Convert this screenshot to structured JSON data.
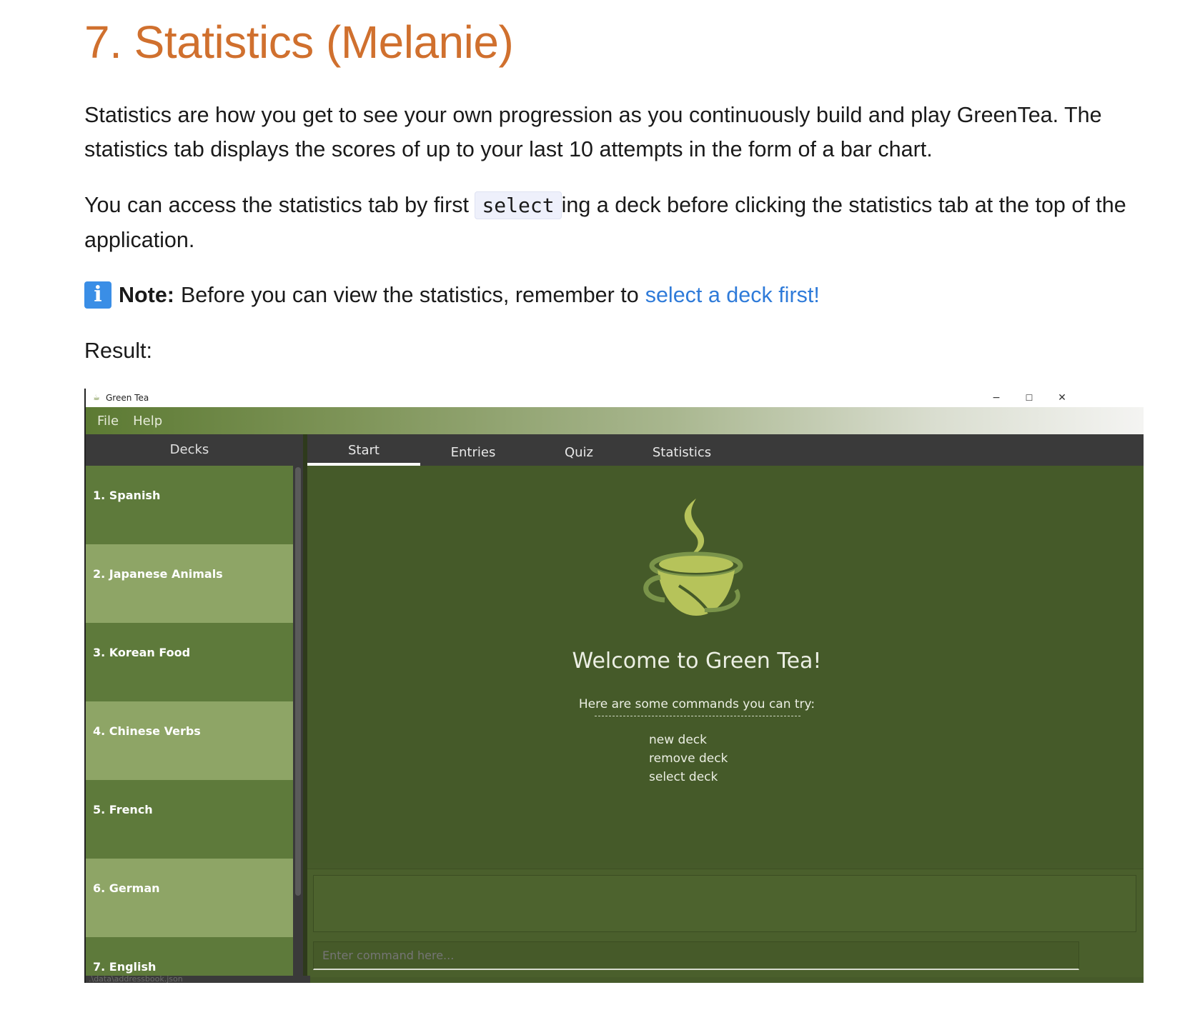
{
  "heading": "7. Statistics (Melanie)",
  "paragraph1": "Statistics are how you get to see your own progression as you continuously build and play GreenTea. The statistics tab displays the scores of up to your last 10 attempts in the form of a bar chart.",
  "paragraph2": {
    "before": "You can access the statistics tab by first ",
    "code": "select",
    "after": "ing a deck before clicking the statistics tab at the top of the application."
  },
  "note": {
    "icon": "info-icon",
    "icon_glyph": "i",
    "label": "Note:",
    "text": "Before you can view the statistics, remember to",
    "link": "select a deck first!"
  },
  "result_label": "Result:",
  "app": {
    "window_title": "Green Tea",
    "window_buttons": {
      "minimize": "−",
      "maximize": "☐",
      "close": "✕"
    },
    "menu": {
      "file": "File",
      "help": "Help"
    },
    "sidebar_title": "Decks",
    "decks": [
      "1.  Spanish",
      "2.  Japanese Animals",
      "3.  Korean Food",
      "4.  Chinese Verbs",
      "5.  French",
      "6.  German",
      "7.  English"
    ],
    "tabs": [
      "Start",
      "Entries",
      "Quiz",
      "Statistics"
    ],
    "active_tab": "Start",
    "welcome_title": "Welcome to Green Tea!",
    "welcome_subtitle": "Here are some commands you can try:",
    "commands": [
      "new deck",
      "remove deck",
      "select deck"
    ],
    "command_placeholder": "Enter command here...",
    "status_path": ".\\data\\addressbook.json",
    "colors": {
      "heading": "#d0702e",
      "link": "#2f7bd9",
      "app_background": "#465a2a",
      "deck_dark": "#5e7a3b",
      "deck_light": "#8ea566",
      "logo_light": "#b6c35a",
      "logo_dark": "#7a944a"
    }
  }
}
